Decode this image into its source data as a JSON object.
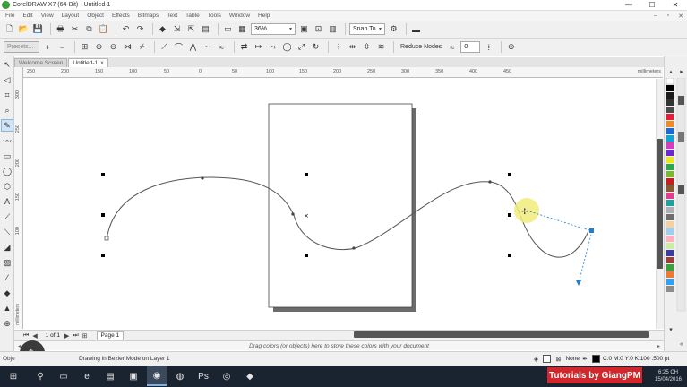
{
  "window": {
    "title": "CorelDRAW X7 (64-Bit) - Untitled-1",
    "minimize": "—",
    "maximize": "☐",
    "close": "✕"
  },
  "menu": {
    "items": [
      "File",
      "Edit",
      "View",
      "Layout",
      "Object",
      "Effects",
      "Bitmaps",
      "Text",
      "Table",
      "Tools",
      "Window",
      "Help"
    ],
    "right_controls": [
      "–",
      "▫",
      "✕"
    ]
  },
  "toolbar": {
    "zoom_value": "36%",
    "snap_to": "Snap To",
    "zoom_arrow": "▾"
  },
  "property_bar": {
    "presets_label": "Presets...",
    "reduce_nodes": "Reduce Nodes",
    "smoothness_value": "0"
  },
  "doc_tabs": [
    {
      "label": "Welcome Screen",
      "active": false
    },
    {
      "label": "Untitled-1",
      "active": true,
      "close": "×"
    }
  ],
  "ruler": {
    "h_ticks": [
      "250",
      "200",
      "150",
      "100",
      "50",
      "0",
      "50",
      "100",
      "150",
      "200",
      "250",
      "300",
      "350",
      "400",
      "450"
    ],
    "h_unit": "millimeters",
    "v_ticks": [
      "300",
      "250",
      "200",
      "150",
      "100"
    ],
    "v_unit": "millimeters"
  },
  "page_nav": {
    "count": "1 of 1",
    "page_tab": "Page 1"
  },
  "color_docker": {
    "message": "Drag colors (or objects) here to store these colors with your document"
  },
  "status": {
    "left": "Obje",
    "message": "Drawing in Bezier Mode on Layer 1",
    "fill_label": "None",
    "outline_label": "C:0 M:0 Y:0 K:100  .500 pt"
  },
  "taskbar": {
    "clock_time": "6:25 CH",
    "clock_date": "15/04/2016"
  },
  "watermark": "Tutorials by GiangPM",
  "colors": {
    "accent_handle": "#1f7fd1",
    "cursor_highlight": "#f2ec7a",
    "watermark_bg": "#d0262c",
    "taskbar_bg": "#1a2330"
  }
}
